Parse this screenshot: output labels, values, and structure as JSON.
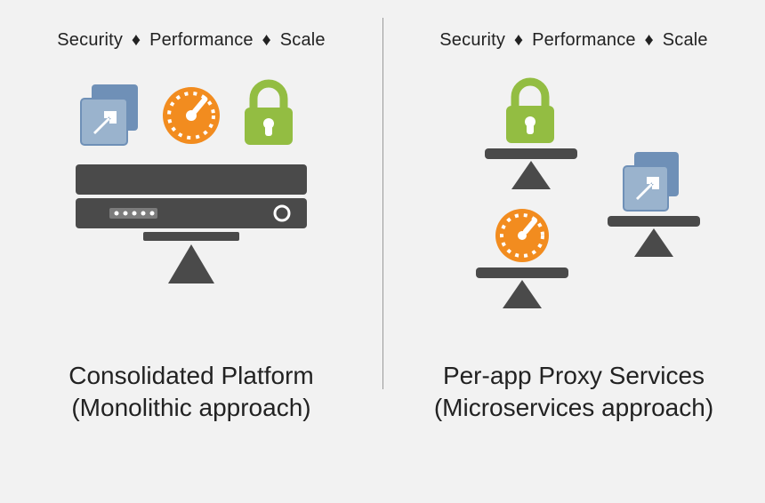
{
  "topline": {
    "segments": [
      "Security",
      "Performance",
      "Scale"
    ],
    "separator": "♦"
  },
  "left": {
    "caption_line1": "Consolidated Platform",
    "caption_line2": "(Monolithic approach)",
    "icons": [
      "app-shortcut-icon",
      "gauge-icon",
      "lock-icon",
      "server-rack-icon",
      "balance-pivot-icon"
    ]
  },
  "right": {
    "caption_line1": "Per-app Proxy Services",
    "caption_line2": "(Microservices approach)",
    "icons": [
      "lock-icon",
      "gauge-icon",
      "app-shortcut-icon",
      "pedestal-icon"
    ]
  },
  "palette": {
    "gray": "#4a4a4a",
    "blue": "#6f90b7",
    "orange": "#f28c1f",
    "green": "#93bd42",
    "bg": "#f2f2f2",
    "white": "#ffffff"
  }
}
